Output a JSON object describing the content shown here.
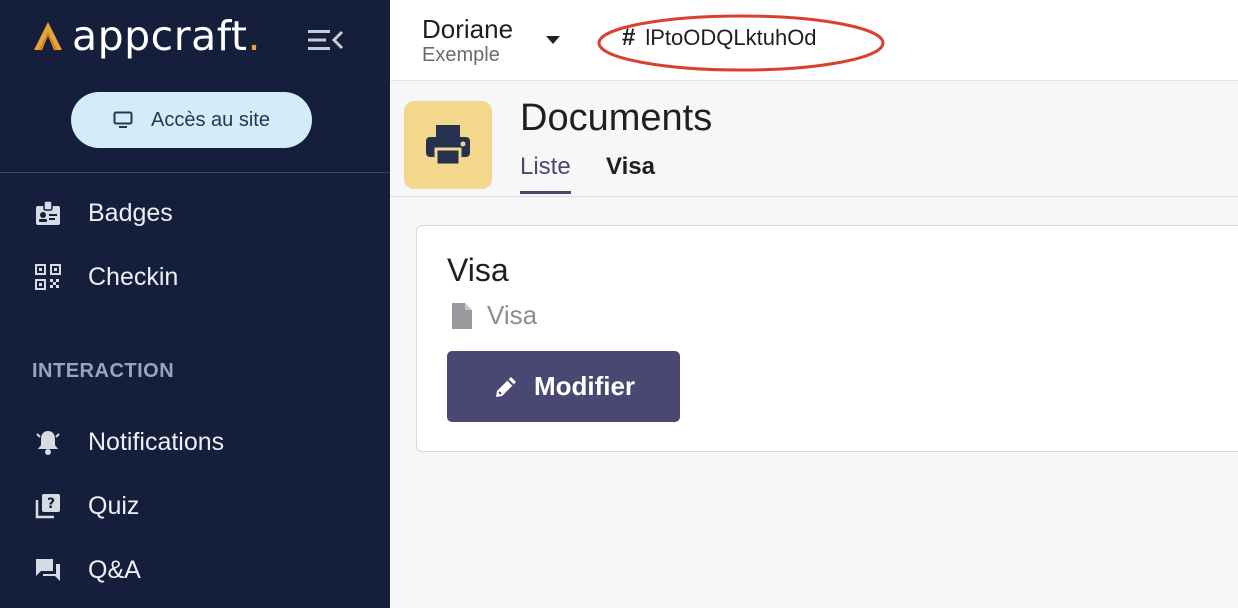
{
  "sidebar": {
    "logo_text": "appcraft",
    "logo_dot": ".",
    "site_button_label": "Accès au site",
    "items": [
      {
        "label": "Badges",
        "icon": "badge-icon"
      },
      {
        "label": "Checkin",
        "icon": "qr-code-icon"
      }
    ],
    "section_title": "INTERACTION",
    "interaction_items": [
      {
        "label": "Notifications",
        "icon": "bell-icon"
      },
      {
        "label": "Quiz",
        "icon": "quiz-icon"
      },
      {
        "label": "Q&A",
        "icon": "chat-icon"
      }
    ]
  },
  "topbar": {
    "user_name": "Doriane",
    "user_subtitle": "Exemple",
    "app_id_symbol": "#",
    "app_id": "lPtoODQLktuhOd"
  },
  "page": {
    "title": "Documents",
    "tabs": [
      {
        "label": "Liste",
        "active": true
      },
      {
        "label": "Visa",
        "active": false
      }
    ]
  },
  "card": {
    "title": "Visa",
    "subtitle": "Visa",
    "edit_button_label": "Modifier"
  },
  "colors": {
    "sidebar_bg": "#151f3b",
    "accent": "#4a4873",
    "logo_accent": "#e8a33b",
    "site_button_bg": "#d2ecfa",
    "page_icon_bg": "#f2d78c",
    "annotation_red": "#d9402f"
  }
}
